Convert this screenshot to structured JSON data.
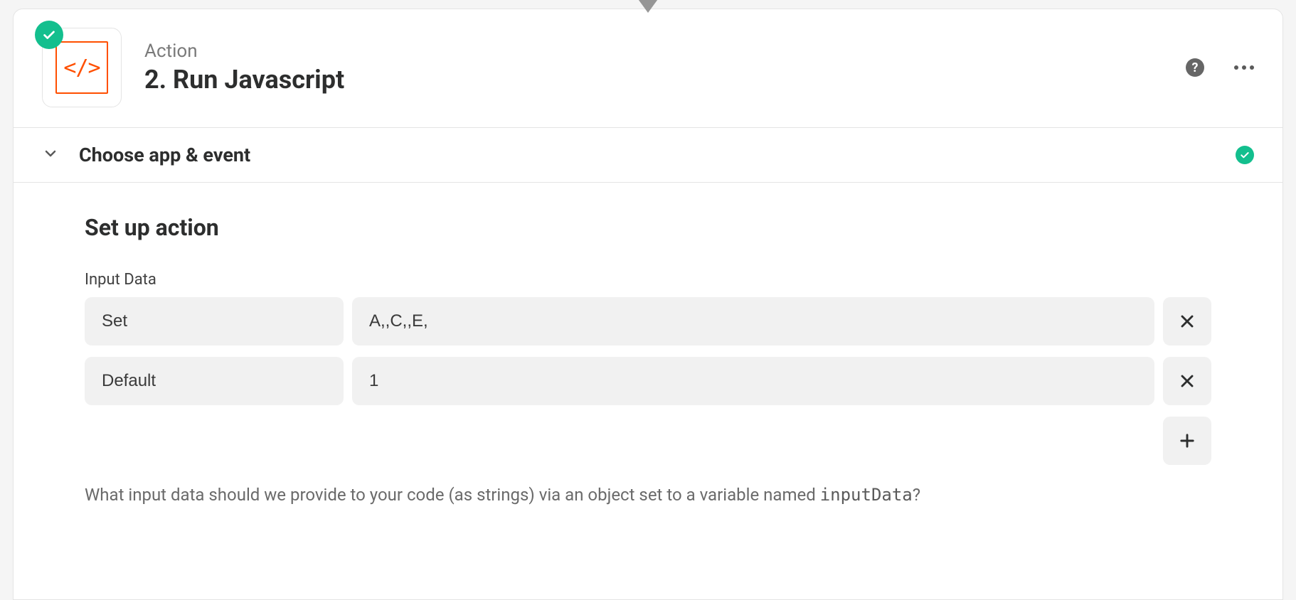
{
  "header": {
    "overline": "Action",
    "title": "2. Run Javascript",
    "code_glyph": "</>"
  },
  "sections": {
    "choose": {
      "label": "Choose app & event"
    }
  },
  "setup": {
    "title": "Set up action",
    "field_label": "Input Data",
    "rows": [
      {
        "key": "Set",
        "value": "A,,C,,E,"
      },
      {
        "key": "Default",
        "value": "1"
      }
    ],
    "helper_prefix": "What input data should we provide to your code (as strings) via an object set to a variable named ",
    "helper_code": "inputData",
    "helper_suffix": "?"
  }
}
